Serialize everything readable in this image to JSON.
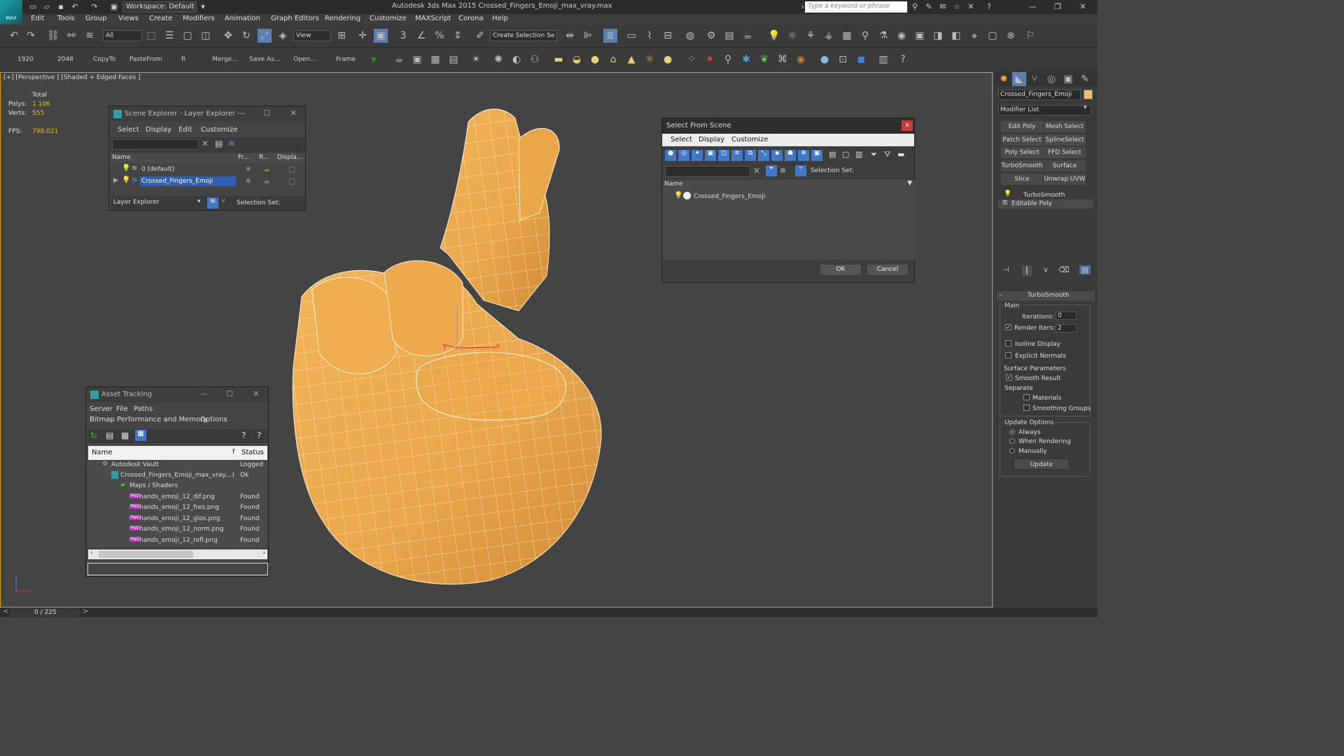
{
  "app": {
    "title": "Autodesk 3ds Max  2015     Crossed_Fingers_Emoji_max_vray.max",
    "logo_text": "MAX",
    "workspace": "Workspace: Default",
    "search_placeholder": "Type a keyword or phrase"
  },
  "menu": [
    "Edit",
    "Tools",
    "Group",
    "Views",
    "Create",
    "Modifiers",
    "Animation",
    "Graph Editors",
    "Rendering",
    "Customize",
    "MAXScript",
    "Corona",
    "Help"
  ],
  "toolbar1": {
    "selection_filter": "All",
    "ref_coord": "View",
    "named_selection": "Create Selection Se"
  },
  "toolbar2": {
    "labels": [
      "1920",
      "2048",
      "CopyTo",
      "PasteFrom",
      "R",
      "Merge...",
      "Save As...",
      "Open...",
      "Frame"
    ]
  },
  "viewport": {
    "label": "[+] [Perspective ] [Shaded + Edged Faces ]",
    "stats": {
      "total_label": "Total",
      "polys_label": "Polys:",
      "polys_value": "1 106",
      "verts_label": "Verts:",
      "verts_value": "555",
      "fps_label": "FPS:",
      "fps_value": "798.021"
    },
    "axis": {
      "x": "x",
      "y": "y",
      "z": "z"
    }
  },
  "scene_explorer": {
    "title": "Scene Explorer - Layer Explorer",
    "menu": [
      "Select",
      "Display",
      "Edit",
      "Customize"
    ],
    "columns": [
      "Name",
      "Fr...",
      "R...",
      "Displa..."
    ],
    "rows": [
      "0 (default)",
      "Crossed_Fingers_Emoji"
    ],
    "footer_dropdown": "Layer Explorer",
    "selection_set": "Selection Set:"
  },
  "select_from_scene": {
    "title": "Select From Scene",
    "close": "x",
    "menu": [
      "Select",
      "Display",
      "Customize"
    ],
    "selection_set": "Selection Set:",
    "column": "Name",
    "item": "Crossed_Fingers_Emoji",
    "ok": "OK",
    "cancel": "Cancel"
  },
  "asset_tracking": {
    "title": "Asset Tracking",
    "menu1": [
      "Server",
      "File",
      "Paths"
    ],
    "menu2": [
      "Bitmap Performance and Memory",
      "Options"
    ],
    "columns": [
      "Name",
      "f",
      "Status"
    ],
    "rows": [
      {
        "name": "Autodesk Vault",
        "status": "Logged"
      },
      {
        "name": "Crossed_Fingers_Emoji_max_vray....",
        "flag": "I",
        "status": "Ok"
      },
      {
        "name": "Maps / Shaders",
        "status": ""
      },
      {
        "name": "hands_emoji_12_dif.png",
        "status": "Found"
      },
      {
        "name": "hands_emoji_12_fres.png",
        "status": "Found"
      },
      {
        "name": "hands_emoji_12_glos.png",
        "status": "Found"
      },
      {
        "name": "hands_emoji_12_norm.png",
        "status": "Found"
      },
      {
        "name": "hands_emoji_12_refl.png",
        "status": "Found"
      }
    ],
    "png_badge": "PNG"
  },
  "command_panel": {
    "object_name": "Crossed_Fingers_Emoji",
    "object_color": "#f0c070",
    "modifier_list": "Modifier List",
    "buttons": [
      "Edit Poly",
      "Mesh Select",
      "Patch Select",
      "SplineSelect",
      "Poly Select",
      "FFD Select",
      "TurboSmooth",
      "Surface Select",
      "Slice",
      "Unwrap UVW"
    ],
    "stack": [
      "TurboSmooth",
      "Editable Poly"
    ],
    "rollout_title": "TurboSmooth",
    "main_label": "Main",
    "iterations_label": "Iterations:",
    "iterations_value": "0",
    "render_iters_label": "Render Iters:",
    "render_iters_value": "2",
    "isoline": "Isoline Display",
    "explicit_normals": "Explicit Normals",
    "surface_params": "Surface Parameters",
    "smooth_result": "Smooth Result",
    "separate": "Separate",
    "materials": "Materials",
    "smoothing_groups": "Smoothing Groups",
    "update_options": "Update Options",
    "always": "Always",
    "when_rendering": "When Rendering",
    "manually": "Manually",
    "update": "Update"
  },
  "timeline": {
    "frame": "0 / 225"
  },
  "colors": {
    "accent": "#c8a000",
    "model": "#e6a24a",
    "selection": "#2f5fb0"
  }
}
